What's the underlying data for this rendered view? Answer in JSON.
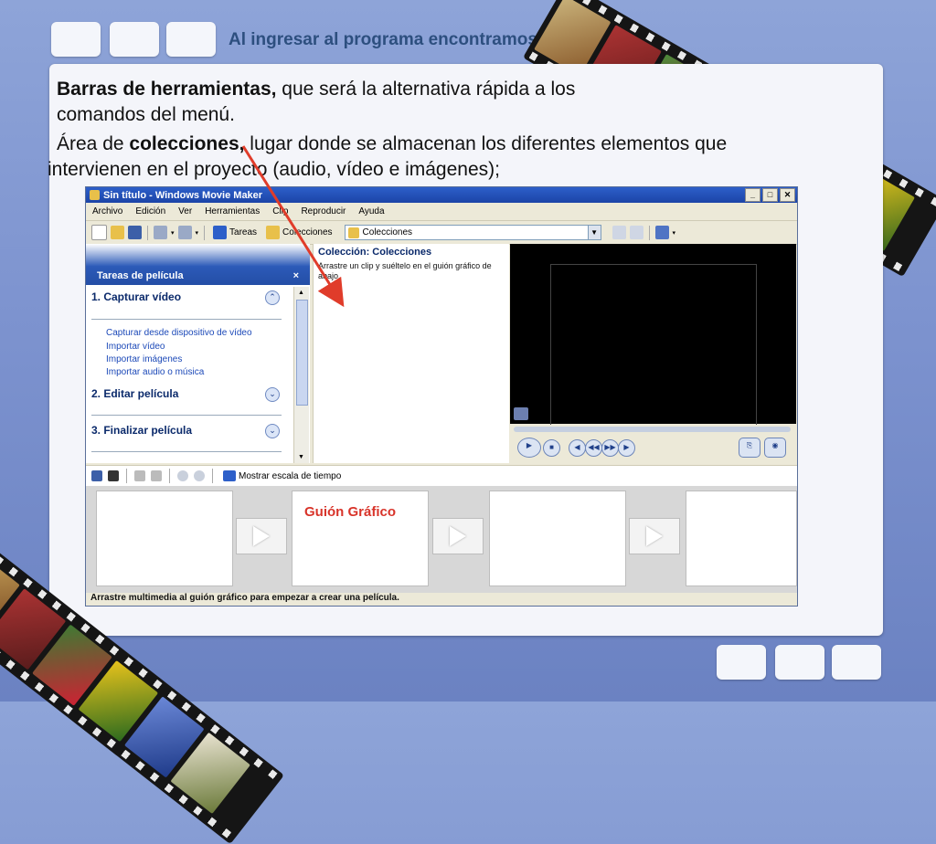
{
  "slide": {
    "title": "Al ingresar al programa encontramos",
    "bullet1_bold": "Barras de herramientas,",
    "bullet1_text": " que será la alternativa rápida a los",
    "bullet1_line2": "comandos del menú.",
    "bullet2_pre": "Área de ",
    "bullet2_bold": "colecciones,",
    "bullet2_text": " lugar donde se almacenan los diferentes elementos que",
    "bullet2_line2": "intervienen en el proyecto (audio, vídeo e imágenes);"
  },
  "window": {
    "title": "Sin título - Windows Movie Maker",
    "menu": [
      "Archivo",
      "Edición",
      "Ver",
      "Herramientas",
      "Clip",
      "Reproducir",
      "Ayuda"
    ],
    "toolbar": {
      "tareas": "Tareas",
      "colecciones": "Colecciones",
      "combo_value": "Colecciones"
    },
    "tasks": {
      "header": "Tareas de película",
      "close": "×",
      "section1": "1. Capturar vídeo",
      "links": [
        "Capturar desde dispositivo de vídeo",
        "Importar vídeo",
        "Importar imágenes",
        "Importar audio o música"
      ],
      "section2": "2. Editar película",
      "section3": "3. Finalizar película"
    },
    "collection": {
      "title": "Colección: Colecciones",
      "hint": "Arrastre un clip y suéltelo en el guión gráfico de abajo."
    },
    "timeline_toggle": "Mostrar escala de tiempo",
    "storyboard_label": "Guión Gráfico",
    "status": "Arrastre multimedia al guión gráfico para empezar a crear una película."
  },
  "colors": {
    "title_text": "#2d4f7f",
    "arrow": "#e03c2a",
    "storyboard_label": "#d8342a"
  }
}
